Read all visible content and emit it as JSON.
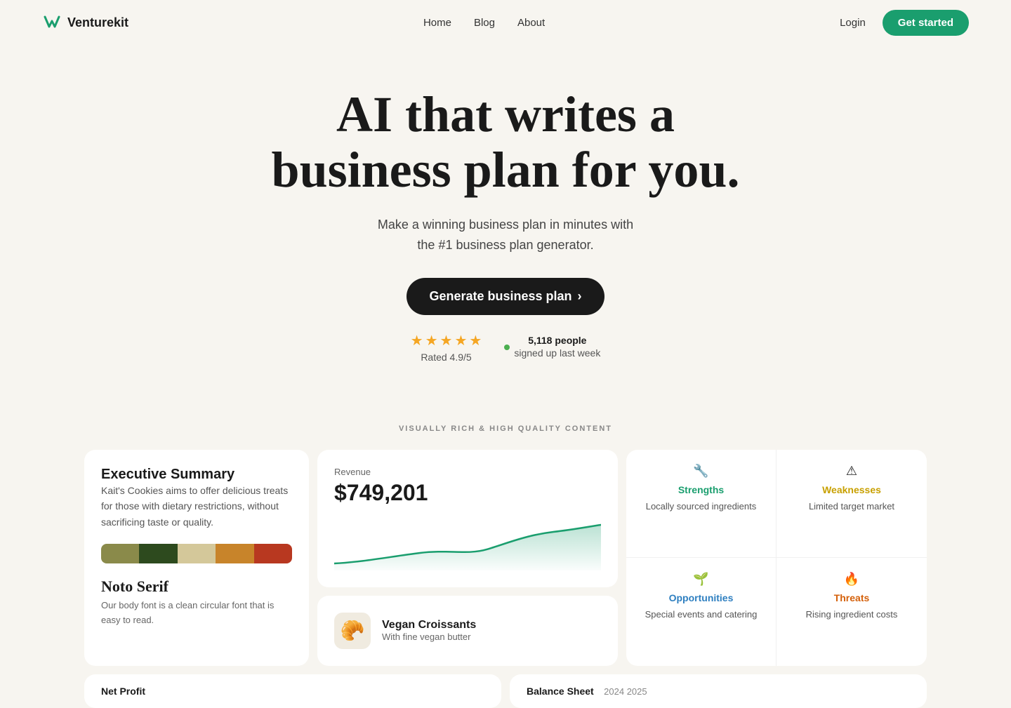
{
  "nav": {
    "logo_text": "Venturekit",
    "links": [
      {
        "label": "Home",
        "id": "home"
      },
      {
        "label": "Blog",
        "id": "blog"
      },
      {
        "label": "About",
        "id": "about"
      }
    ],
    "login_label": "Login",
    "get_started_label": "Get started"
  },
  "hero": {
    "headline_line1": "AI that writes a",
    "headline_line2": "business plan for you.",
    "subtext": "Make a winning business plan in minutes with\nthe #1 business plan generator.",
    "cta_label": "Generate business plan",
    "cta_arrow": "›"
  },
  "social_proof": {
    "rating": "Rated 4.9/5",
    "stars": 5,
    "signups_count": "5,118 people",
    "signups_text": "signed up last week"
  },
  "section_label": "VISUALLY RICH & HIGH QUALITY CONTENT",
  "exec_card": {
    "title": "Executive Summary",
    "body": "Kait's Cookies aims to offer delicious treats for those with dietary restrictions, without sacrificing taste or quality.",
    "font_name": "Noto Serif",
    "font_desc": "Our body font is a clean circular font that is easy to read.",
    "colors": [
      "#8a8a4a",
      "#2d4a1e",
      "#d4c89a",
      "#c8842a",
      "#b83820"
    ]
  },
  "revenue_card": {
    "label": "Revenue",
    "amount": "$749,201"
  },
  "swot": {
    "strengths": {
      "icon": "🔧",
      "title": "Strengths",
      "desc": "Locally sourced ingredients"
    },
    "weaknesses": {
      "icon": "⚠",
      "title": "Weaknesses",
      "desc": "Limited target market"
    },
    "opportunities": {
      "icon": "🌱",
      "title": "Opportunities",
      "desc": "Special events and catering"
    },
    "threats": {
      "icon": "🔥",
      "title": "Threats",
      "desc": "Rising ingredient costs"
    }
  },
  "product_card": {
    "name": "Vegan Croissants",
    "desc": "With fine vegan butter"
  },
  "bottom_cards": [
    {
      "title": "Net Profit"
    },
    {
      "title": "Balance Sheet",
      "cols": "2024   2025"
    }
  ]
}
